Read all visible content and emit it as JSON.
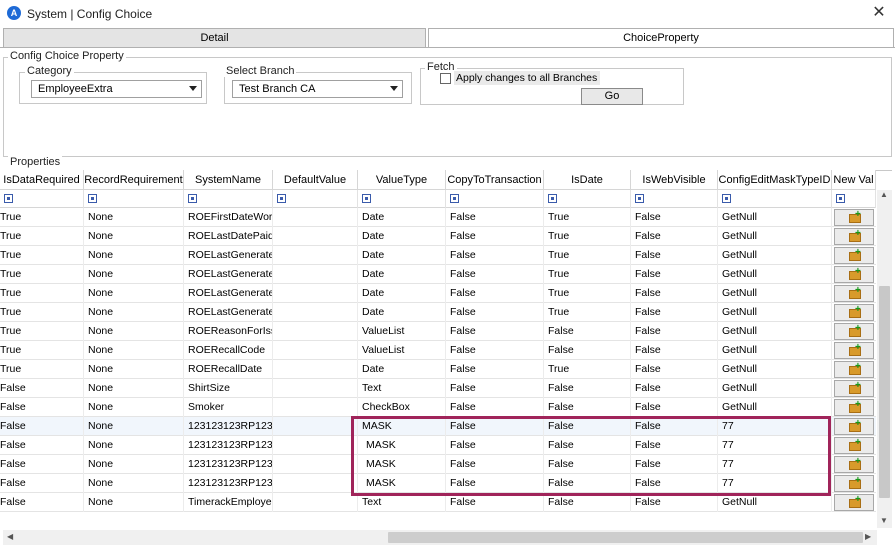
{
  "window": {
    "title": "System | Config Choice"
  },
  "tabs": {
    "detail": "Detail",
    "choice_property": "ChoiceProperty"
  },
  "config": {
    "group_label": "Config Choice Property",
    "category_label": "Category",
    "category_value": "EmployeeExtra",
    "branch_label": "Select Branch",
    "branch_value": "Test Branch CA",
    "fetch_label": "Fetch",
    "apply_label": "Apply changes to all Branches",
    "go_label": "Go"
  },
  "properties": {
    "group_label": "Properties",
    "columns": [
      "IsDataRequired",
      "RecordRequirement",
      "SystemName",
      "DefaultValue",
      "ValueType",
      "CopyToTransaction",
      "IsDate",
      "IsWebVisible",
      "ConfigEditMaskTypeID",
      "New Val"
    ],
    "rows": [
      [
        "True",
        "None",
        "ROEFirstDateWor",
        "",
        "Date",
        "False",
        "True",
        "False",
        "GetNull"
      ],
      [
        "True",
        "None",
        "ROELastDatePaid",
        "",
        "Date",
        "False",
        "True",
        "False",
        "GetNull"
      ],
      [
        "True",
        "None",
        "ROELastGenerate",
        "",
        "Date",
        "False",
        "True",
        "False",
        "GetNull"
      ],
      [
        "True",
        "None",
        "ROELastGenerate",
        "",
        "Date",
        "False",
        "True",
        "False",
        "GetNull"
      ],
      [
        "True",
        "None",
        "ROELastGenerate",
        "",
        "Date",
        "False",
        "True",
        "False",
        "GetNull"
      ],
      [
        "True",
        "None",
        "ROELastGenerate",
        "",
        "Date",
        "False",
        "True",
        "False",
        "GetNull"
      ],
      [
        "True",
        "None",
        "ROEReasonForIss",
        "",
        "ValueList",
        "False",
        "False",
        "False",
        "GetNull"
      ],
      [
        "True",
        "None",
        "ROERecallCode",
        "",
        "ValueList",
        "False",
        "False",
        "False",
        "GetNull"
      ],
      [
        "True",
        "None",
        "ROERecallDate",
        "",
        "Date",
        "False",
        "True",
        "False",
        "GetNull"
      ],
      [
        "False",
        "None",
        "ShirtSize",
        "",
        "Text",
        "False",
        "False",
        "False",
        "GetNull"
      ],
      [
        "False",
        "None",
        "Smoker",
        "",
        "CheckBox",
        "False",
        "False",
        "False",
        "GetNull"
      ],
      [
        "False",
        "None",
        "123123123RP123",
        "",
        "MASK",
        "False",
        "False",
        "False",
        "77"
      ],
      [
        "False",
        "None",
        "123123123RP123",
        "",
        "MASK",
        "False",
        "False",
        "False",
        "77"
      ],
      [
        "False",
        "None",
        "123123123RP123",
        "",
        "MASK",
        "False",
        "False",
        "False",
        "77"
      ],
      [
        "False",
        "None",
        "123123123RP123",
        "",
        "MASK",
        "False",
        "False",
        "False",
        "77"
      ],
      [
        "False",
        "None",
        "TimerackEmploye",
        "",
        "Text",
        "False",
        "False",
        "False",
        "GetNull"
      ]
    ]
  },
  "icons": [
    "close-icon",
    "dropdown-arrow-icon",
    "filter-icon",
    "new-folder-icon"
  ],
  "colors": {
    "highlight_border": "#a0245a",
    "selected_row": "#f1f6fc"
  }
}
